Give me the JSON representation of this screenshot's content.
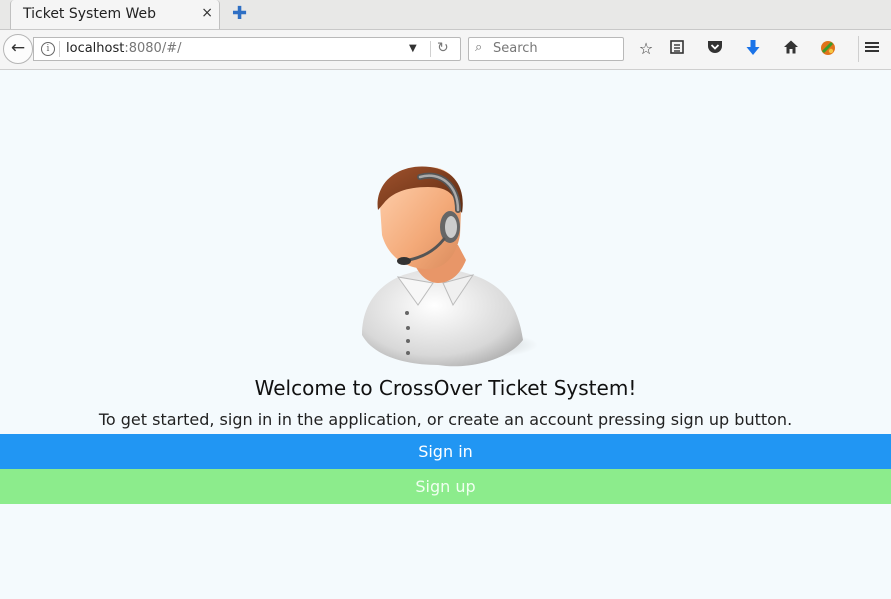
{
  "browser": {
    "tab_title": "Ticket System Web",
    "tab_close": "×",
    "new_tab": "✚",
    "url_host": "localhost",
    "url_rest": ":8080/#/",
    "search_placeholder": "Search",
    "toolbar_icons": [
      "bookmark-star-icon",
      "reading-list-icon",
      "pocket-icon",
      "download-icon",
      "home-icon",
      "extension-icon",
      "menu-icon"
    ]
  },
  "page": {
    "welcome": "Welcome to CrossOver Ticket System!",
    "subtitle": "To get started, sign in in the application, or create an account pressing sign up button.",
    "signin_label": "Sign in",
    "signup_label": "Sign up"
  },
  "colors": {
    "signin": "#2196f3",
    "signup": "#8cec8c",
    "background": "#f4fafd"
  }
}
